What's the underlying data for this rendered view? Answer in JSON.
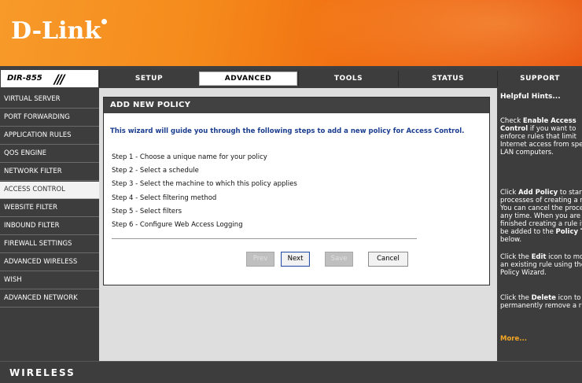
{
  "header": {
    "logo_text": "D-Link"
  },
  "model": {
    "name": "DIR-855",
    "slashes": "///"
  },
  "tabs": [
    {
      "label": "SETUP"
    },
    {
      "label": "ADVANCED"
    },
    {
      "label": "TOOLS"
    },
    {
      "label": "STATUS"
    },
    {
      "label": "SUPPORT"
    }
  ],
  "sidebar": {
    "items": [
      {
        "label": "VIRTUAL SERVER"
      },
      {
        "label": "PORT FORWARDING"
      },
      {
        "label": "APPLICATION RULES"
      },
      {
        "label": "QOS ENGINE"
      },
      {
        "label": "NETWORK FILTER"
      },
      {
        "label": "ACCESS CONTROL"
      },
      {
        "label": "WEBSITE FILTER"
      },
      {
        "label": "INBOUND FILTER"
      },
      {
        "label": "FIREWALL SETTINGS"
      },
      {
        "label": "ADVANCED WIRELESS"
      },
      {
        "label": "WISH"
      },
      {
        "label": "ADVANCED NETWORK"
      }
    ]
  },
  "panel": {
    "title": "ADD NEW POLICY",
    "intro": "This wizard will guide you through the following steps to add a new policy for Access Control.",
    "steps": [
      "Step 1 - Choose a unique name for your policy",
      "Step 2 - Select a schedule",
      "Step 3 - Select the machine to which this policy applies",
      "Step 4 - Select filtering method",
      "Step 5 - Select filters",
      "Step 6 - Configure Web Access Logging"
    ],
    "buttons": {
      "prev": "Prev",
      "next": "Next",
      "save": "Save",
      "cancel": "Cancel"
    }
  },
  "hints": {
    "title": "Helpful Hints...",
    "h1_pre": "Check ",
    "h1_bold": "Enable Access Control",
    "h1_post": " if you want to enforce rules that limit Internet access from specific LAN computers.",
    "h2_pre": "Click ",
    "h2_bold": "Add Policy",
    "h2_post": " to start the processes of creating a rule. You can cancel the process at any time. When you are finished creating a rule it will be added to the ",
    "h2_bold2": "Policy Table",
    "h2_post2": " below.",
    "h3_pre": "Click the ",
    "h3_bold": "Edit",
    "h3_post": " icon to modify an existing rule using the Policy Wizard.",
    "h4_pre": "Click the ",
    "h4_bold": "Delete",
    "h4_post": " icon to permanently remove a rule.",
    "more": "More..."
  },
  "footer": {
    "brand": "WIRELESS"
  },
  "colors": {
    "header_orange": "#f58a1b",
    "nav_dark": "#3d3d3d",
    "intro_blue": "#1b3d8f",
    "more_orange": "#f5a623"
  }
}
